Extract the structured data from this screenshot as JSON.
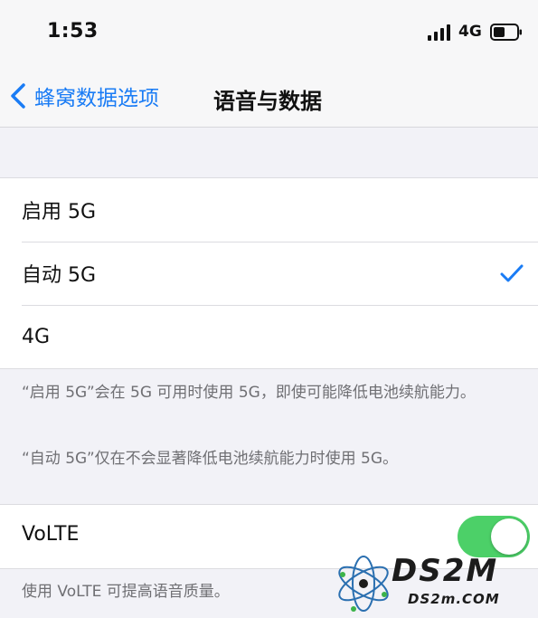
{
  "status_bar": {
    "time": "1:53",
    "network": "4G",
    "icons": [
      "signal-icon",
      "battery-icon"
    ]
  },
  "nav": {
    "back_label": "蜂窝数据选项",
    "title": "语音与数据"
  },
  "options": [
    {
      "label": "启用 5G",
      "selected": false
    },
    {
      "label": "自动 5G",
      "selected": true
    },
    {
      "label": "4G",
      "selected": false
    }
  ],
  "footer_note_1": "“启用 5G”会在 5G 可用时使用 5G，即使可能降低电池续航能力。",
  "footer_note_2": "“自动 5G”仅在不会显著降低电池续航能力时使用 5G。",
  "volte": {
    "label": "VoLTE",
    "enabled": true,
    "footer": "使用 VoLTE 可提高语音质量。"
  },
  "watermark": {
    "logo": "DS2M",
    "domain": "DS2m.COM"
  },
  "colors": {
    "accent": "#1a7cf5",
    "toggle_on": "#4cd068",
    "background": "#f2f2f7"
  }
}
